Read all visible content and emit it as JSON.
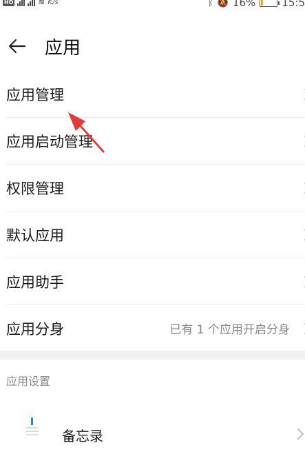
{
  "status": {
    "hd": "HD",
    "speed": "K/s",
    "battery": "16%",
    "battery_level": 0.16,
    "time": "15:5",
    "accent_battery": "#f5a623"
  },
  "header": {
    "title": "应用",
    "back_icon": "arrow-left-icon"
  },
  "items": [
    {
      "label": "应用管理",
      "value": ""
    },
    {
      "label": "应用启动管理",
      "value": ""
    },
    {
      "label": "权限管理",
      "value": ""
    },
    {
      "label": "默认应用",
      "value": ""
    },
    {
      "label": "应用助手",
      "value": ""
    },
    {
      "label": "应用分身",
      "value": "已有 1 个应用开启分身"
    }
  ],
  "section_title": "应用设置",
  "app": {
    "name": "备忘录",
    "icon": "notepad-icon",
    "icon_color": "#1e88e5"
  },
  "annotation": {
    "icon": "red-arrow-icon",
    "color": "#e53935"
  }
}
